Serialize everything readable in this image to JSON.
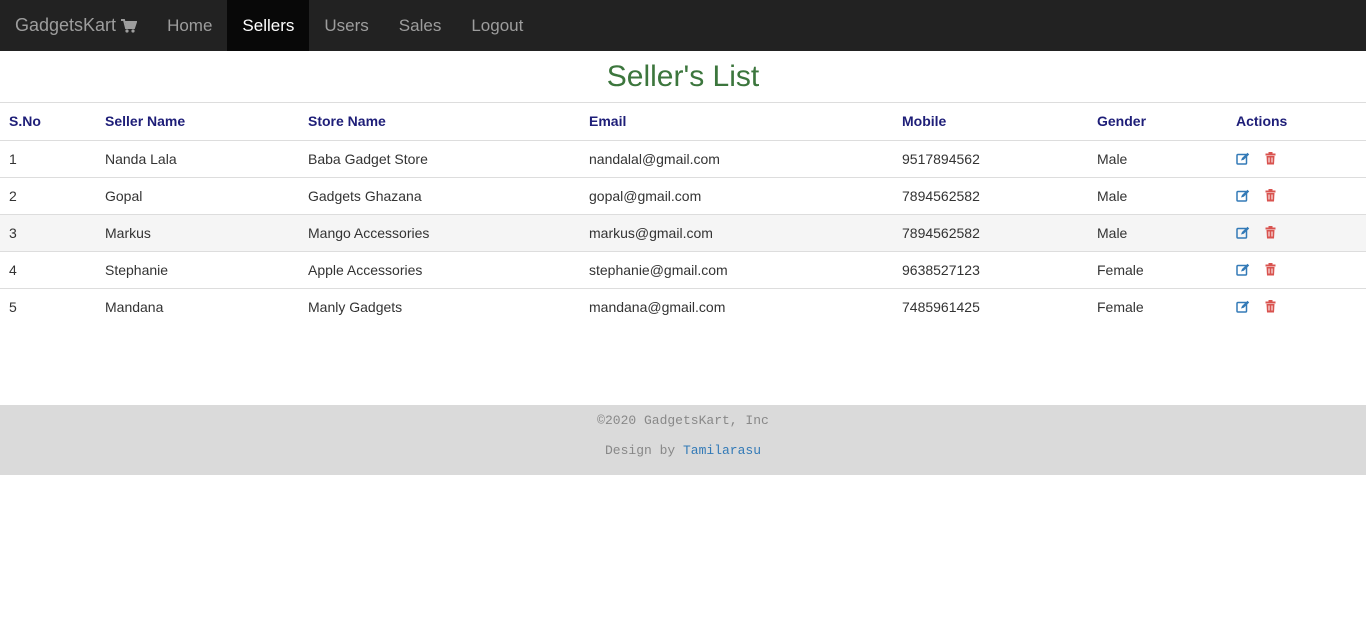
{
  "navbar": {
    "brand": "GadgetsKart",
    "brand_icon": "shopping-cart-icon",
    "items": [
      {
        "label": "Home",
        "active": false
      },
      {
        "label": "Sellers",
        "active": true
      },
      {
        "label": "Users",
        "active": false
      },
      {
        "label": "Sales",
        "active": false
      },
      {
        "label": "Logout",
        "active": false
      }
    ]
  },
  "page": {
    "title": "Seller's List"
  },
  "table": {
    "headers": [
      "S.No",
      "Seller Name",
      "Store Name",
      "Email",
      "Mobile",
      "Gender",
      "Actions"
    ],
    "rows": [
      [
        "1",
        "Nanda Lala",
        "Baba Gadget Store",
        "nandalal@gmail.com",
        "9517894562",
        "Male"
      ],
      [
        "2",
        "Gopal",
        "Gadgets Ghazana",
        "gopal@gmail.com",
        "7894562582",
        "Male"
      ],
      [
        "3",
        "Markus",
        "Mango Accessories",
        "markus@gmail.com",
        "7894562582",
        "Male"
      ],
      [
        "4",
        "Stephanie",
        "Apple Accessories",
        "stephanie@gmail.com",
        "9638527123",
        "Female"
      ],
      [
        "5",
        "Mandana",
        "Manly Gadgets",
        "mandana@gmail.com",
        "7485961425",
        "Female"
      ]
    ],
    "action_icons": [
      "edit-icon",
      "trash-icon"
    ]
  },
  "footer": {
    "copyright": "©2020 GadgetsKart, Inc",
    "design_prefix": "Design by ",
    "designer": "Tamilarasu"
  },
  "colors": {
    "navbar_bg": "#222222",
    "title": "#3c763d",
    "header_text": "#1e1e78",
    "edit_icon": "#337ab7",
    "delete_icon": "#d9534f",
    "footer_bg": "#dadada"
  }
}
